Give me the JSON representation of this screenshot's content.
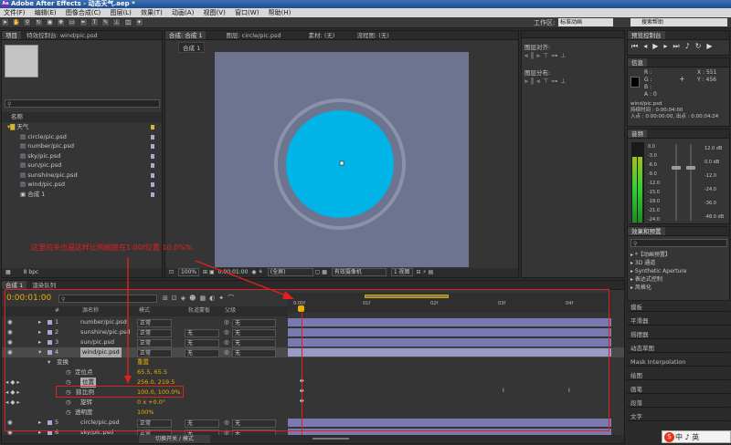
{
  "title": "Adobe After Effects - 动态天气.aep *",
  "menu": [
    "文件(F)",
    "编辑(E)",
    "图像合成(C)",
    "图层(L)",
    "效果(T)",
    "动画(A)",
    "视图(V)",
    "窗口(W)",
    "帮助(H)"
  ],
  "toolbar": {
    "workspace_label": "工作区:",
    "workspace_value": "标准动画",
    "search_placeholder": "搜索帮助"
  },
  "project": {
    "tabs": [
      "项目",
      "特效控制台: wind/pic.psd"
    ],
    "search_placeholder": "",
    "column_name": "名称",
    "items": [
      {
        "name": "天气",
        "type": "folder",
        "color": "#d4b72e"
      },
      {
        "name": "circle/pic.psd",
        "type": "file",
        "color": "#b3a3d6"
      },
      {
        "name": "number/pic.psd",
        "type": "file",
        "color": "#b3a3d6"
      },
      {
        "name": "sky/pic.psd",
        "type": "file",
        "color": "#b3a3d6"
      },
      {
        "name": "sun/pic.psd",
        "type": "file",
        "color": "#b3a3d6"
      },
      {
        "name": "sunshine/pic.psd",
        "type": "file",
        "color": "#b3a3d6"
      },
      {
        "name": "wind/pic.psd",
        "type": "file",
        "color": "#b3a3d6"
      },
      {
        "name": "合成 1",
        "type": "comp",
        "color": "#b3a3d6"
      }
    ],
    "bpc": "8 bpc"
  },
  "composition": {
    "tabs": [
      "合成: 合成 1",
      "图层: circle/pic.psd",
      "素材: (无)",
      "流程图: (无)"
    ],
    "subtab": "合成 1",
    "zoom": "100%",
    "timecode": "0:00:01:00",
    "resolution": "(全屏)",
    "camera": "有效摄像机",
    "view": "1 视图"
  },
  "align": {
    "title1": "图层对齐:",
    "title2": "图层分布:"
  },
  "preview": {
    "tab": "预览控制台"
  },
  "info": {
    "tab": "信息",
    "r": "R :",
    "g": "G :",
    "b": "B :",
    "a": "A : 0",
    "x": "X : 551",
    "y": "Y : 456",
    "layer": "wind/pic.psd",
    "duration": "持续时间 : 0:00:04:00",
    "inout": "入点 : 0:00:00:00, 出点 : 0:00:04:24"
  },
  "audio": {
    "tab": "音频",
    "left_scale": [
      "0.0",
      "-3.0",
      "-6.0",
      "-9.0",
      "-12.0",
      "-15.0",
      "-18.0",
      "-21.0",
      "-24.0"
    ],
    "right_scale": [
      "12.0 dB",
      "0.0 dB",
      "-12.0",
      "-24.0",
      "-36.0",
      "-48.0 dB"
    ],
    "right_levels": [
      0.3,
      0.5
    ]
  },
  "effects": {
    "tab": "效果和预置",
    "search_placeholder": "",
    "items": [
      "*【动画预置】",
      "3D 通道",
      "Synthetic Aperture",
      "表达式控制",
      "风格化"
    ]
  },
  "right_panels": [
    "摸板",
    "平滑器",
    "摇摆器",
    "动态草图",
    "Mask Interpolation",
    "绘图",
    "画笔",
    "段落",
    "文字"
  ],
  "annotation": "这里的关也是这样比例缩放在1:00f位置  10.0%%.",
  "timeline": {
    "tabs": [
      "合成 1",
      "渲染队列"
    ],
    "timecode": "0:00:01:00",
    "ruler": [
      "0:00f",
      "01f",
      "02f",
      "03f",
      "04f"
    ],
    "columns": {
      "num": "#",
      "name": "源名称",
      "mode": "模式",
      "trkmat": "轨道蒙板",
      "parent": "父级"
    },
    "layers": [
      {
        "num": "1",
        "name": "number/pic.psd",
        "mode": "正常",
        "trkmat": "",
        "parent": "无",
        "color": "#b3a3d6"
      },
      {
        "num": "2",
        "name": "sunshine/pic.psd",
        "mode": "正常",
        "trkmat": "无",
        "parent": "无",
        "color": "#b3a3d6"
      },
      {
        "num": "3",
        "name": "sun/pic.psd",
        "mode": "正常",
        "trkmat": "无",
        "parent": "无",
        "color": "#b3a3d6"
      },
      {
        "num": "4",
        "name": "wind/pic.psd",
        "mode": "正常",
        "trkmat": "无",
        "parent": "无",
        "color": "#b3a3d6"
      }
    ],
    "transform": {
      "label": "变换",
      "reset": "重置",
      "props": [
        {
          "name": "定位点",
          "value": "65.5, 65.5"
        },
        {
          "name": "位置",
          "value": "256.0, 219.5"
        },
        {
          "name": "比例",
          "value": "100.0, 100.0%"
        },
        {
          "name": "旋转",
          "value": "0 x +0.0°"
        },
        {
          "name": "透明度",
          "value": "100%"
        }
      ]
    },
    "layers_after": [
      {
        "num": "5",
        "name": "circle/pic.psd",
        "mode": "正常",
        "trkmat": "无",
        "parent": "无",
        "color": "#b3a3d6"
      },
      {
        "num": "6",
        "name": "sky/pic.psd",
        "mode": "正常",
        "trkmat": "无",
        "parent": "无",
        "color": "#b3a3d6"
      }
    ],
    "footer": "切换开关 / 模式"
  },
  "taskbar": {
    "ime": "中 ♪ 英"
  },
  "colors": {
    "circle": "#00b4e8",
    "ring": "#8a92a8",
    "comp_bg": "#6c7490",
    "layer_bar": "#7a7ab0",
    "accent_red": "#e02020"
  }
}
